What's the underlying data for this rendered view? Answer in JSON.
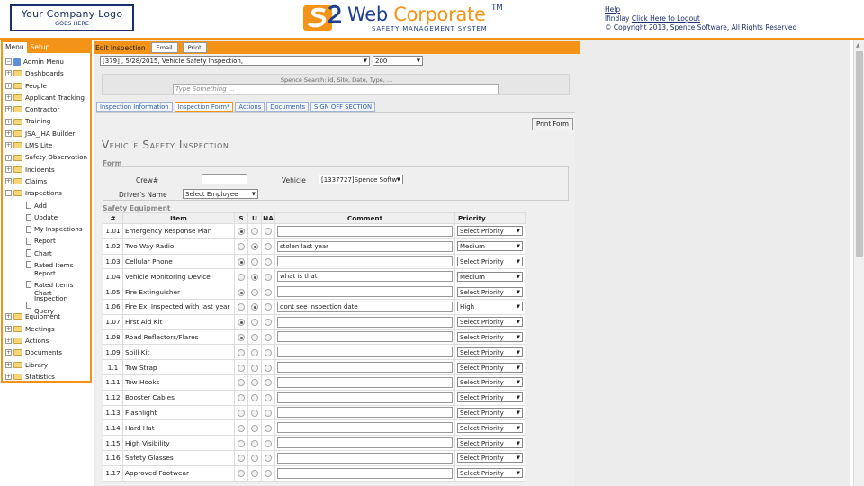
{
  "header": {
    "logo_line1": "Your Company Logo",
    "logo_line2": "GOES HERE",
    "brand_web": "Web",
    "brand_corp": "Corporate",
    "brand_tm": "TM",
    "brand_sub": "SAFETY MANAGEMENT SYSTEM",
    "help": "Help",
    "user": "lfindlay",
    "logout": "Click Here to Logout",
    "copyright": "© Copyright 2013, Spence Software, All Rights Reserved"
  },
  "colors": {
    "accent": "#f39419",
    "brand": "#1f3f8f"
  },
  "menu": {
    "tab_menu": "Menu",
    "tab_setup": "Setup",
    "root": "Admin Menu",
    "items": [
      "Dashboards",
      "People",
      "Applicant Tracking",
      "Contractor",
      "Training",
      "JSA_JHA Builder",
      "LMS Lite",
      "Safety Observation",
      "Incidents",
      "Claims",
      "Inspections"
    ],
    "inspection_sub": [
      "Add",
      "Update",
      "My Inspections",
      "Report",
      "Chart",
      "Rated Items Report",
      "Rated Items Chart",
      "Inspection Query"
    ],
    "items_after": [
      "Equipment",
      "Meetings",
      "Actions",
      "Documents",
      "Library",
      "Statistics"
    ]
  },
  "edit": {
    "title": "Edit Inspection",
    "email_btn": "Email",
    "print_btn": "Print",
    "inspection_select": "[379] , 5/28/2015, Vehicle Safety Inspection,",
    "code_select": "200",
    "search_label": "Spence Search: id, Site, Date, Type, ...",
    "search_placeholder": "Type Something ..."
  },
  "tabs": [
    "Inspection Information",
    "Inspection Form*",
    "Actions",
    "Documents",
    "SIGN OFF SECTION"
  ],
  "form": {
    "print_form": "Print Form",
    "page_title": "Vehicle Safety Inspection",
    "legend": "Form",
    "crew_label": "Crew#",
    "crew_value": "",
    "vehicle_label": "Vehicle",
    "vehicle_value": "[1337727]Spence Softw",
    "driver_label": "Driver's Name",
    "driver_value": "Select Employee"
  },
  "safety": {
    "legend": "Safety Equipment",
    "headers": [
      "#",
      "Item",
      "S",
      "U",
      "NA",
      "Comment",
      "Priority"
    ],
    "rows": [
      {
        "num": "1.01",
        "item": "Emergency Response Plan",
        "sel": "S",
        "comment": "",
        "priority": "Select Priority"
      },
      {
        "num": "1.02",
        "item": "Two Way Radio",
        "sel": "U",
        "comment": "stolen last year",
        "priority": "Medium"
      },
      {
        "num": "1.03",
        "item": "Cellular Phone",
        "sel": "S",
        "comment": "",
        "priority": "Select Priority"
      },
      {
        "num": "1.04",
        "item": "Vehicle Monitoring Device",
        "sel": "U",
        "comment": "what is that",
        "priority": "Medium"
      },
      {
        "num": "1.05",
        "item": "Fire Extinguisher",
        "sel": "S",
        "comment": "",
        "priority": "Select Priority"
      },
      {
        "num": "1.06",
        "item": "Fire Ex. Inspected with last year",
        "sel": "U",
        "comment": "dont see inspection date",
        "priority": "High"
      },
      {
        "num": "1.07",
        "item": "First Aid Kit",
        "sel": "S",
        "comment": "",
        "priority": "Select Priority"
      },
      {
        "num": "1.08",
        "item": "Road Reflectors/Flares",
        "sel": "S",
        "comment": "",
        "priority": "Select Priority"
      },
      {
        "num": "1.09",
        "item": "Spill Kit",
        "sel": "",
        "comment": "",
        "priority": "Select Priority"
      },
      {
        "num": "1.1",
        "item": "Tow Strap",
        "sel": "",
        "comment": "",
        "priority": "Select Priority"
      },
      {
        "num": "1.11",
        "item": "Tow Hooks",
        "sel": "",
        "comment": "",
        "priority": "Select Priority"
      },
      {
        "num": "1.12",
        "item": "Booster Cables",
        "sel": "",
        "comment": "",
        "priority": "Select Priority"
      },
      {
        "num": "1.13",
        "item": "Flashlight",
        "sel": "",
        "comment": "",
        "priority": "Select Priority"
      },
      {
        "num": "1.14",
        "item": "Hard Hat",
        "sel": "",
        "comment": "",
        "priority": "Select Priority"
      },
      {
        "num": "1.15",
        "item": "High Visibility",
        "sel": "",
        "comment": "",
        "priority": "Select Priority"
      },
      {
        "num": "1.16",
        "item": "Safety Glasses",
        "sel": "",
        "comment": "",
        "priority": "Select Priority"
      },
      {
        "num": "1.17",
        "item": "Approved Footwear",
        "sel": "",
        "comment": "",
        "priority": "Select Priority"
      }
    ]
  }
}
